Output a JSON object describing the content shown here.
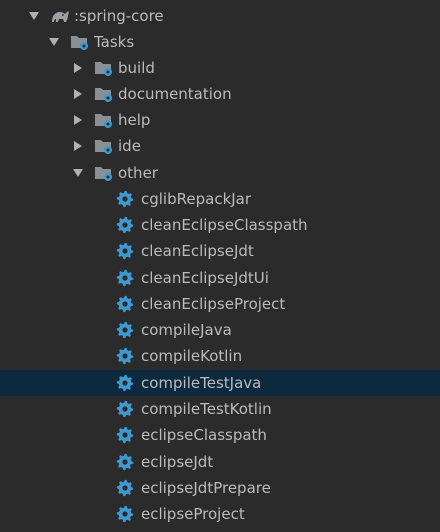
{
  "tree": {
    "root": {
      "label": ":spring-core",
      "expanded": true
    },
    "tasks": {
      "label": "Tasks",
      "expanded": true
    },
    "groups": [
      {
        "label": "build",
        "expanded": false
      },
      {
        "label": "documentation",
        "expanded": false
      },
      {
        "label": "help",
        "expanded": false
      },
      {
        "label": "ide",
        "expanded": false
      },
      {
        "label": "other",
        "expanded": true
      }
    ],
    "other_tasks": [
      {
        "label": "cglibRepackJar"
      },
      {
        "label": "cleanEclipseClasspath"
      },
      {
        "label": "cleanEclipseJdt"
      },
      {
        "label": "cleanEclipseJdtUi"
      },
      {
        "label": "cleanEclipseProject"
      },
      {
        "label": "compileJava"
      },
      {
        "label": "compileKotlin"
      },
      {
        "label": "compileTestJava",
        "selected": true
      },
      {
        "label": "compileTestKotlin"
      },
      {
        "label": "eclipseClasspath"
      },
      {
        "label": "eclipseJdt"
      },
      {
        "label": "eclipseJdtPrepare"
      },
      {
        "label": "eclipseProject"
      }
    ]
  },
  "colors": {
    "background": "#2b2b2b",
    "text": "#bbbbbb",
    "selection": "#0d293e",
    "gear": "#3d9ad1",
    "folder": "#8a8f94"
  },
  "icons": {
    "expanded": "chevron-down-icon",
    "collapsed": "chevron-right-icon",
    "root": "gradle-elephant-icon",
    "group": "task-folder-icon",
    "task": "gear-icon"
  }
}
